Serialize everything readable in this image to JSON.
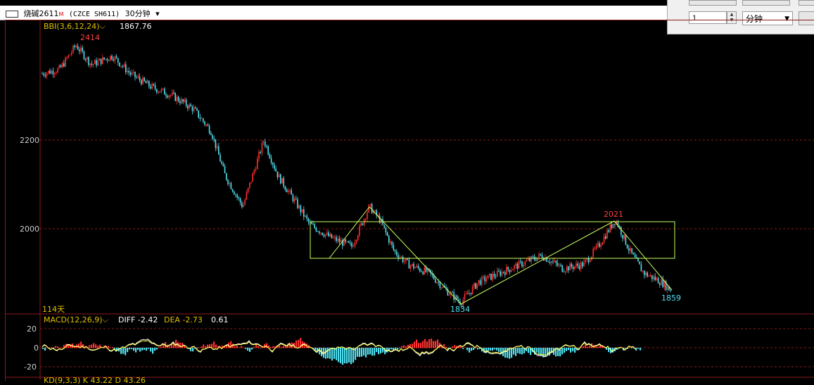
{
  "header": {
    "symbol": "烧碱2611",
    "market_suffix": "M",
    "exchange_code": "(CZCE SH611)",
    "period": "30分钟"
  },
  "panel": {
    "count_value": "1",
    "unit_select": "分钟"
  },
  "main_chart": {
    "indicator_label": "BBI(3,6,12,24)",
    "indicator_value": "1867.76",
    "y_ticks": [
      "2200",
      "2000"
    ],
    "high_label": "2414",
    "peak2_label": "2021",
    "low_label": "1834",
    "last_low_label": "1859",
    "days_label": "114天"
  },
  "macd": {
    "label": "MACD(12,26,9)",
    "diff_label": "DIFF",
    "diff_value": "-2.42",
    "dea_label": "DEA",
    "dea_value": "-2.73",
    "macd_value": "0.61",
    "y_ticks": [
      "20",
      "0",
      "-20"
    ]
  },
  "kd": {
    "label": "KD(9,3,3)",
    "k_label": "K",
    "k_value": "43.22",
    "d_label": "D",
    "d_value": "43.26"
  },
  "colors": {
    "up": "#ff3030",
    "down": "#50e0f0",
    "grid": "#8b1a1a",
    "trendline": "#c8ff60",
    "diff_line": "#ffffff",
    "dea_line": "#ffff40"
  },
  "chart_data": {
    "type": "line",
    "series": [
      {
        "x": [
          60,
          85,
          108,
          130,
          160,
          185,
          215,
          245,
          275,
          300,
          320,
          345,
          375,
          395,
          420,
          440,
          470,
          500,
          525,
          540,
          560,
          580,
          610,
          635,
          655,
          680,
          710,
          740,
          770,
          800,
          830,
          850,
          875,
          895,
          915,
          940,
          955
        ],
        "values": [
          2350,
          2360,
          2414,
          2370,
          2390,
          2350,
          2320,
          2300,
          2270,
          2220,
          2120,
          2050,
          2200,
          2120,
          2060,
          2010,
          1980,
          1960,
          2050,
          2020,
          1950,
          1920,
          1900,
          1860,
          1834,
          1880,
          1900,
          1920,
          1940,
          1910,
          1920,
          1960,
          2021,
          1950,
          1900,
          1880,
          1859
        ]
      }
    ],
    "ylim": [
      1820,
      2450
    ]
  }
}
